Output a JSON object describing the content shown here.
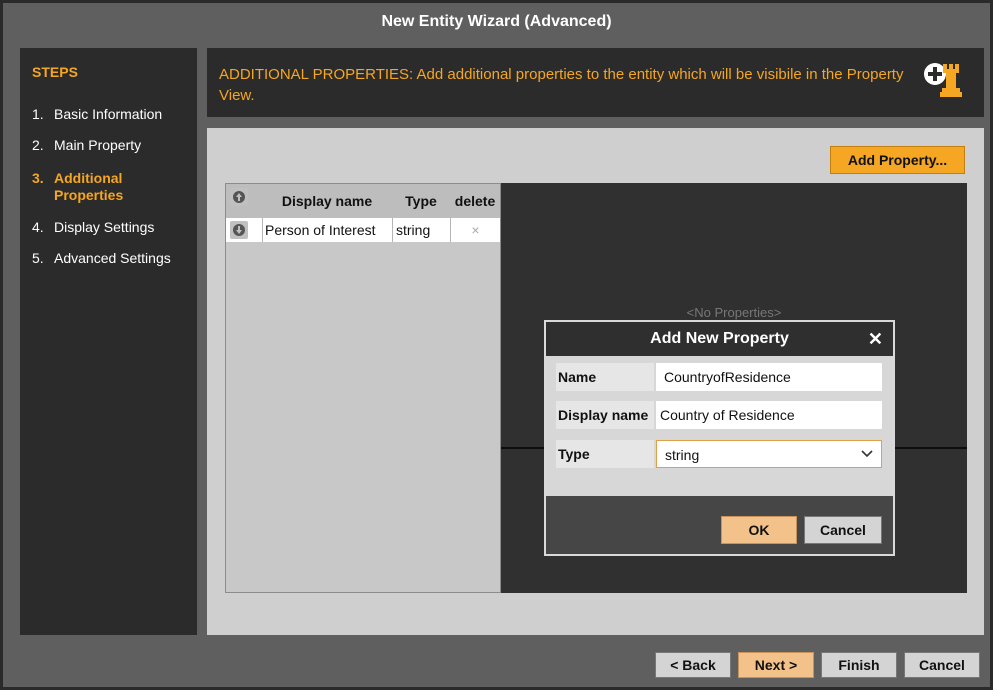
{
  "window": {
    "title": "New Entity Wizard (Advanced)"
  },
  "steps": {
    "heading": "STEPS",
    "items": [
      {
        "num": "1.",
        "label": "Basic Information"
      },
      {
        "num": "2.",
        "label": "Main Property"
      },
      {
        "num": "3.",
        "label": "Additional Properties"
      },
      {
        "num": "4.",
        "label": "Display Settings"
      },
      {
        "num": "5.",
        "label": "Advanced Settings"
      }
    ]
  },
  "header": {
    "text": "ADDITIONAL PROPERTIES: Add additional properties to the entity which will be visibile in the Property View.",
    "icon": "add-entity-rook-icon"
  },
  "content": {
    "add_property_label": "Add Property...",
    "table": {
      "columns": [
        "Display name",
        "Type",
        "delete"
      ],
      "rows": [
        {
          "display_name": "Person of Interest",
          "type": "string",
          "delete": "×"
        }
      ]
    },
    "no_properties": "<No Properties>"
  },
  "dialog": {
    "title": "Add New Property",
    "close": "✕",
    "fields": {
      "name_label": "Name",
      "name_value": "CountryofResidence",
      "display_name_label": "Display name",
      "display_name_value": "Country of Residence",
      "type_label": "Type",
      "type_value": "string"
    },
    "ok_label": "OK",
    "cancel_label": "Cancel"
  },
  "footer": {
    "back_label": "< Back",
    "next_label": "Next >",
    "finish_label": "Finish",
    "cancel_label": "Cancel"
  },
  "colors": {
    "accent": "#f5a623",
    "panel": "#2b2b2b",
    "frame": "#5f5f5f",
    "content": "#cfcfcf"
  }
}
